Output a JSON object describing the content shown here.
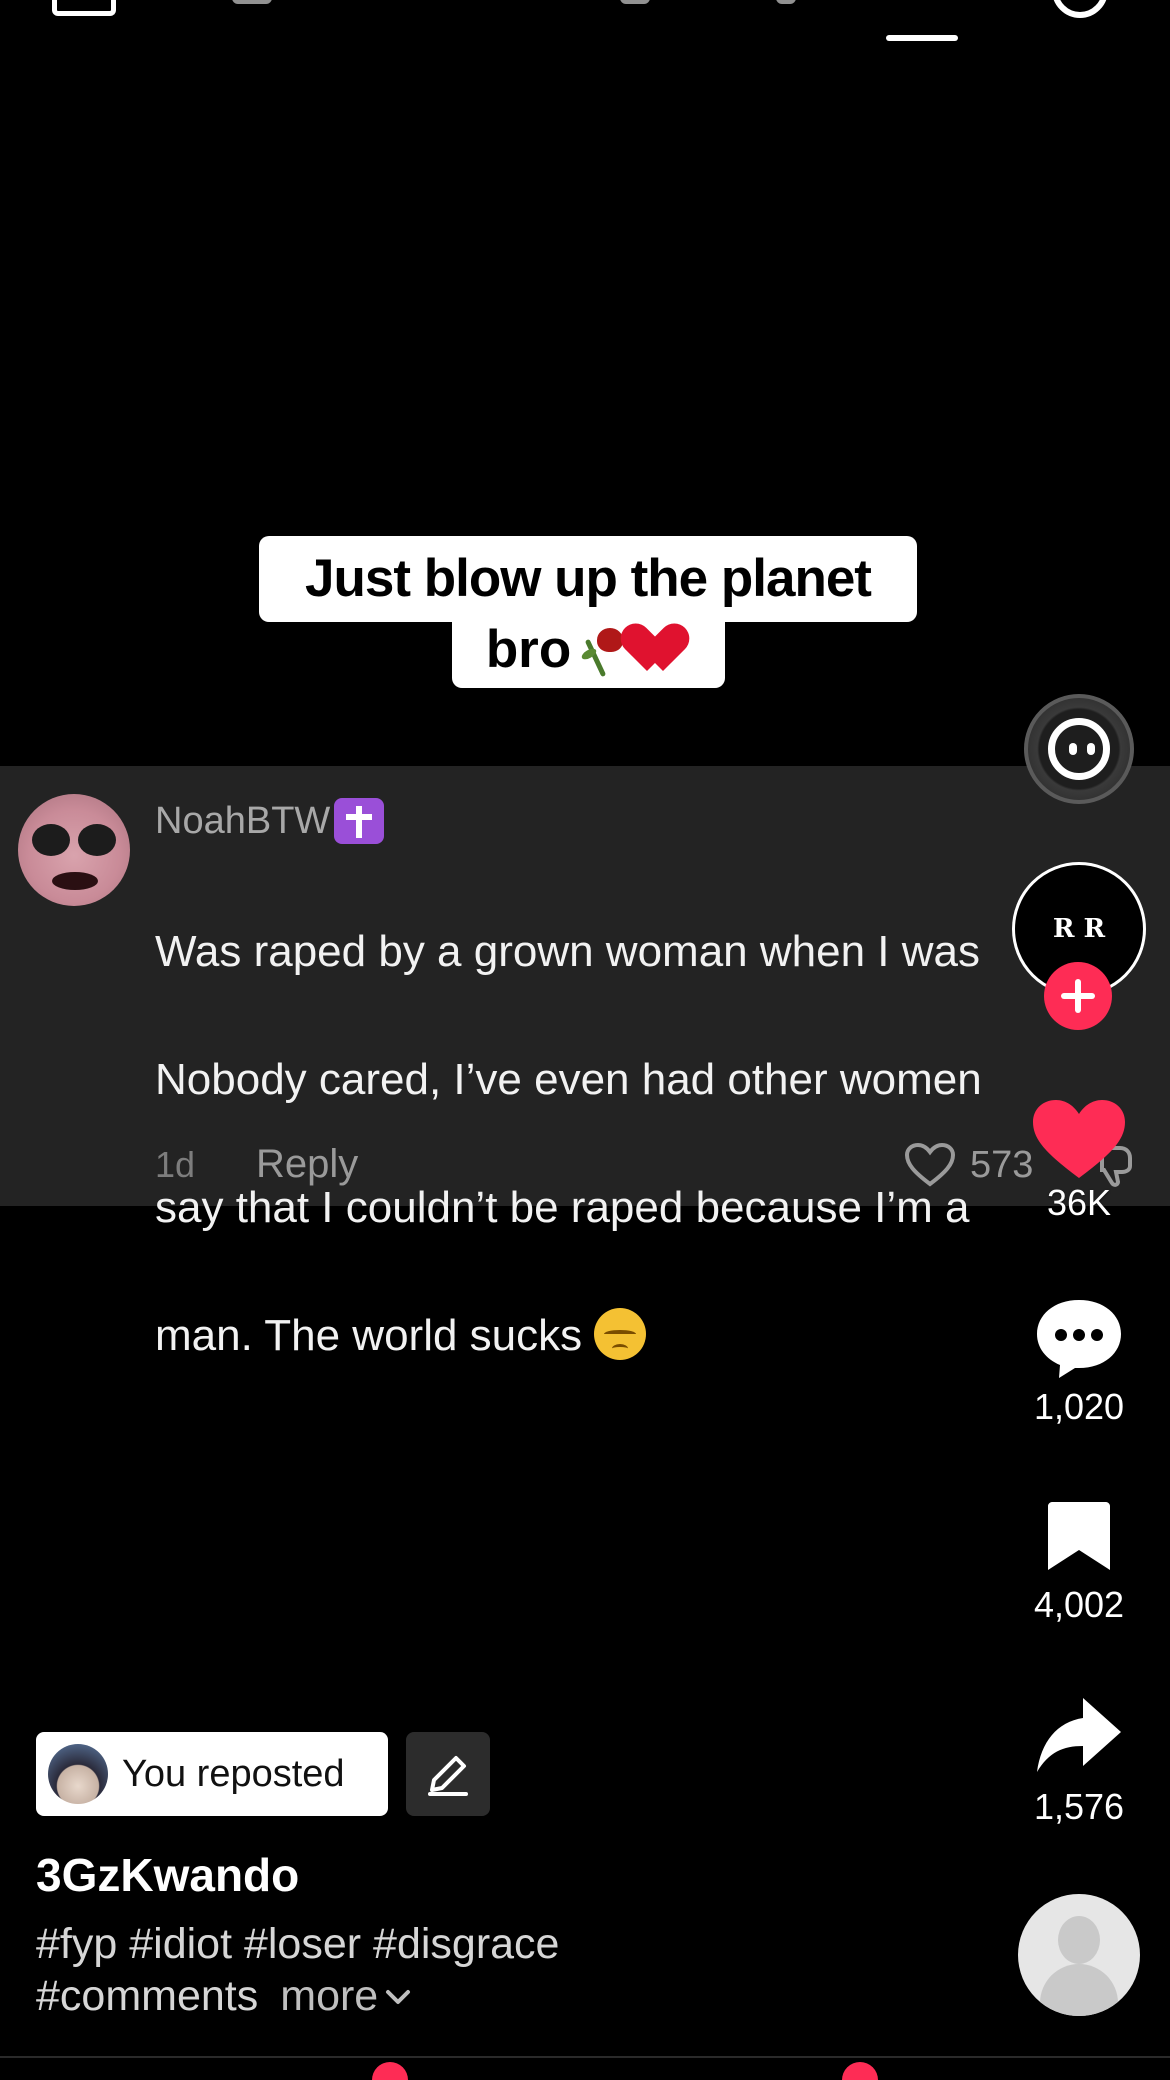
{
  "video": {
    "caption_line1": "Just blow up the planet",
    "caption_line2": "bro"
  },
  "comment": {
    "username": "NoahBTW",
    "lines": [
      "Was raped by a grown woman when I was",
      "Nobody cared, I’ve even had other women",
      "say that I couldn’t be raped because I’m a",
      "man. The world sucks"
    ],
    "time": "1d",
    "reply_label": "Reply",
    "like_count": "573"
  },
  "rail": {
    "creator_initials": "R R",
    "likes": "36K",
    "comments": "1,020",
    "saves": "4,002",
    "shares": "1,576"
  },
  "repost": {
    "label": "You reposted"
  },
  "post": {
    "author": "3GzKwando",
    "hashtags": "#fyp #idiot #loser #disgrace #comments",
    "more_label": "more"
  },
  "colors": {
    "accent": "#fe2c55",
    "comment_bg": "#232323",
    "badge_purple": "#9a4fd8"
  },
  "icons": {
    "effect": "effect-face-icon",
    "like": "heart-icon",
    "comment": "speech-bubble-icon",
    "save": "bookmark-icon",
    "share": "share-arrow-icon",
    "edit": "pencil-icon"
  }
}
